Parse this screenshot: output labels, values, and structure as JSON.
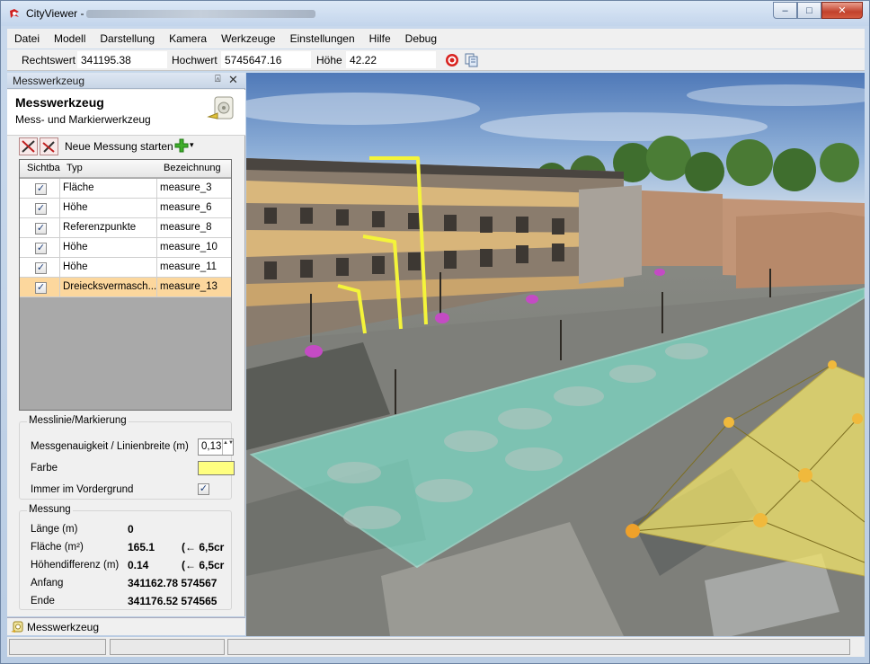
{
  "window": {
    "title": "CityViewer -",
    "buttons": {
      "minimize": "–",
      "maximize": "□",
      "close": "✕"
    }
  },
  "menu": [
    "Datei",
    "Modell",
    "Darstellung",
    "Kamera",
    "Werkzeuge",
    "Einstellungen",
    "Hilfe",
    "Debug"
  ],
  "coords": {
    "rechtswert_label": "Rechtswert",
    "rechtswert_value": "341195.38",
    "hochwert_label": "Hochwert",
    "hochwert_value": "5745647.16",
    "hoehe_label": "Höhe",
    "hoehe_value": "42.22"
  },
  "panel": {
    "header_title": "Messwerkzeug",
    "pin_icon": "⍓",
    "close_icon": "✕",
    "tool_title": "Messwerkzeug",
    "tool_subtitle": "Mess- und Markierwerkzeug",
    "new_measurement_label": "Neue Messung starten",
    "dropdown_arrow": "▾"
  },
  "grid": {
    "headers": {
      "visible": "Sichtba",
      "type": "Typ",
      "name": "Bezeichnung"
    },
    "rows": [
      {
        "visible": true,
        "type": "Fläche",
        "name": "measure_3",
        "selected": false
      },
      {
        "visible": true,
        "type": "Höhe",
        "name": "measure_6",
        "selected": false
      },
      {
        "visible": true,
        "type": "Referenzpunkte",
        "name": "measure_8",
        "selected": false
      },
      {
        "visible": true,
        "type": "Höhe",
        "name": "measure_10",
        "selected": false
      },
      {
        "visible": true,
        "type": "Höhe",
        "name": "measure_11",
        "selected": false
      },
      {
        "visible": true,
        "type": "Dreiecksvermasch...",
        "name": "measure_13",
        "selected": true
      }
    ],
    "check_mark": "✓"
  },
  "messlinie": {
    "title": "Messlinie/Markierung",
    "accuracy_label": "Messgenauigkeit / Linienbreite (m)",
    "accuracy_value": "0,13",
    "spin_arrows": "▲▼",
    "color_label": "Farbe",
    "color_value": "#ffff80",
    "foreground_label": "Immer im Vordergrund",
    "foreground_checked": true
  },
  "messung": {
    "title": "Messung",
    "laenge_label": "Länge (m)",
    "laenge_value": "0",
    "flaeche_label": "Fläche (m²)",
    "flaeche_value": "165.1",
    "flaeche_note": "(← 6,5cr",
    "hoehendiff_label": "Höhendifferenz (m)",
    "hoehendiff_value": "0.14",
    "hoehendiff_note": "(← 6,5cr",
    "anfang_label": "Anfang",
    "anfang_value": "341162.78 574567",
    "ende_label": "Ende",
    "ende_value": "341176.52 574565"
  },
  "bottom_tab": {
    "label": "Messwerkzeug"
  },
  "colors": {
    "accent_selection": "#fcd79d",
    "measure_line": "#f4f43a",
    "surface_overlay": "#7df0d8",
    "triangulation": "#f2e56b",
    "marker": "#c44bc4"
  }
}
